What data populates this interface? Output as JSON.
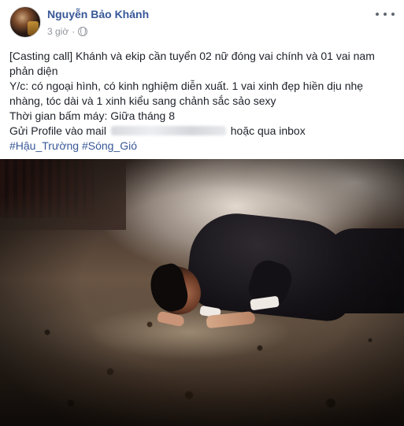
{
  "post": {
    "author": "Nguyễn Bảo Khánh",
    "time": "3 giờ",
    "separator": "·",
    "privacy_icon": "globe-icon",
    "more_icon": "more-horizontal-icon"
  },
  "content": {
    "line1": "[Casting call] Khánh và ekip cần tuyển 02 nữ đóng vai chính và 01 vai nam phản diện",
    "line2": "Y/c: có ngoại hình, có kinh nghiệm diễn xuất. 1 vai xinh đẹp hiền dịu nhẹ nhàng, tóc dài và 1 xinh kiểu sang chảnh sắc sảo sexy",
    "line3": "Thời gian bấm máy: Giữa tháng 8",
    "line4_before": "Gửi Profile vào mail",
    "line4_after": "hoặc qua inbox",
    "hashtag1": "#Hậu_Trường",
    "hashtag2": "#Sóng_Gió"
  },
  "colors": {
    "link": "#385898",
    "meta": "#90949c",
    "text": "#1d2129"
  }
}
